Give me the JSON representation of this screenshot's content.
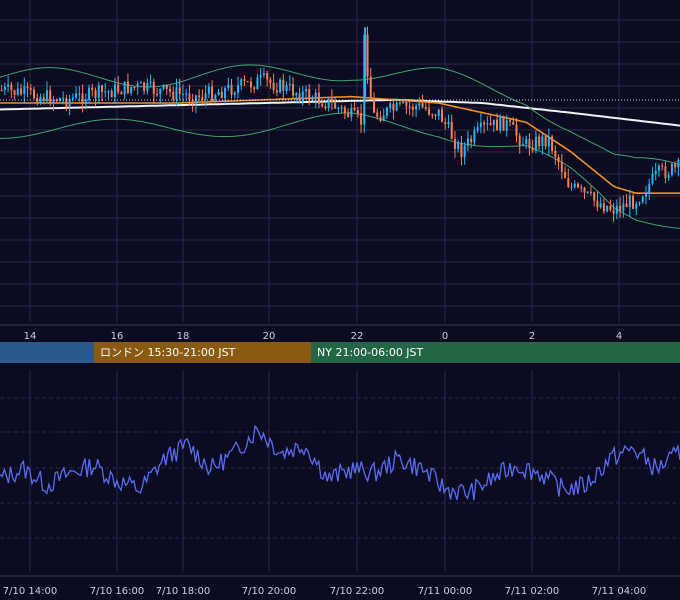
{
  "colors": {
    "background": "#0b0b22",
    "grid": "#2a2a46",
    "candle_up": "#29b6f6",
    "candle_down": "#ff7f50",
    "bollinger": "#3fa66a",
    "ema": "#f0902a",
    "sma": "#f2f2f2",
    "oscillator": "#5a6cf0",
    "tokyo": "#2a5a8c",
    "london": "#8a5a12",
    "ny": "#226644"
  },
  "sessions": {
    "tokyo": "",
    "london": "ロンドン 15:30-21:00 JST",
    "ny": "NY 21:00-06:00 JST"
  },
  "chart_data": [
    {
      "type": "candlestick",
      "title": "",
      "x_ticks": [
        "14",
        "16",
        "18",
        "20",
        "22",
        "0",
        "2",
        "4"
      ],
      "indicators": [
        "Bollinger Bands",
        "EMA",
        "SMA"
      ],
      "price_line_dotted": true,
      "price_path": [
        [
          0,
          0.28
        ],
        [
          3,
          0.31
        ],
        [
          6,
          0.27
        ],
        [
          9,
          0.3
        ],
        [
          12,
          0.25
        ],
        [
          15,
          0.32
        ],
        [
          16.5,
          0.38
        ],
        [
          16.6,
          0.12
        ],
        [
          17,
          0.36
        ],
        [
          18,
          0.34
        ],
        [
          19,
          0.33
        ],
        [
          20,
          0.35
        ],
        [
          21,
          0.47
        ],
        [
          22,
          0.4
        ],
        [
          23,
          0.38
        ],
        [
          24,
          0.45
        ],
        [
          25,
          0.43
        ],
        [
          26,
          0.58
        ],
        [
          27,
          0.62
        ],
        [
          28,
          0.65
        ],
        [
          29,
          0.62
        ],
        [
          30,
          0.54
        ],
        [
          31,
          0.52
        ]
      ],
      "ema_path": [
        [
          0,
          0.32
        ],
        [
          4,
          0.32
        ],
        [
          8,
          0.32
        ],
        [
          12,
          0.31
        ],
        [
          16,
          0.3
        ],
        [
          20,
          0.32
        ],
        [
          24,
          0.38
        ],
        [
          26,
          0.47
        ],
        [
          28,
          0.58
        ],
        [
          29,
          0.6
        ],
        [
          31,
          0.6
        ]
      ],
      "sma_path": [
        [
          0,
          0.34
        ],
        [
          6,
          0.33
        ],
        [
          12,
          0.32
        ],
        [
          18,
          0.31
        ],
        [
          22,
          0.32
        ],
        [
          26,
          0.35
        ],
        [
          31,
          0.39
        ]
      ],
      "bollinger_width": 0.08
    },
    {
      "type": "line",
      "title": "",
      "x_ticks": [
        "7/10 14:00",
        "7/10 16:00",
        "7/10 18:00",
        "7/10 20:00",
        "7/10 22:00",
        "7/11 00:00",
        "7/11 02:00",
        "7/11 04:00"
      ],
      "series": [
        {
          "values": [
            0.45,
            0.5,
            0.42,
            0.48,
            0.52,
            0.44,
            0.4,
            0.55,
            0.62,
            0.5,
            0.58,
            0.7,
            0.58,
            0.62,
            0.45,
            0.5,
            0.48,
            0.55,
            0.5,
            0.4,
            0.38,
            0.45,
            0.52,
            0.48,
            0.4,
            0.42,
            0.55,
            0.6,
            0.5,
            0.58
          ]
        }
      ]
    }
  ]
}
